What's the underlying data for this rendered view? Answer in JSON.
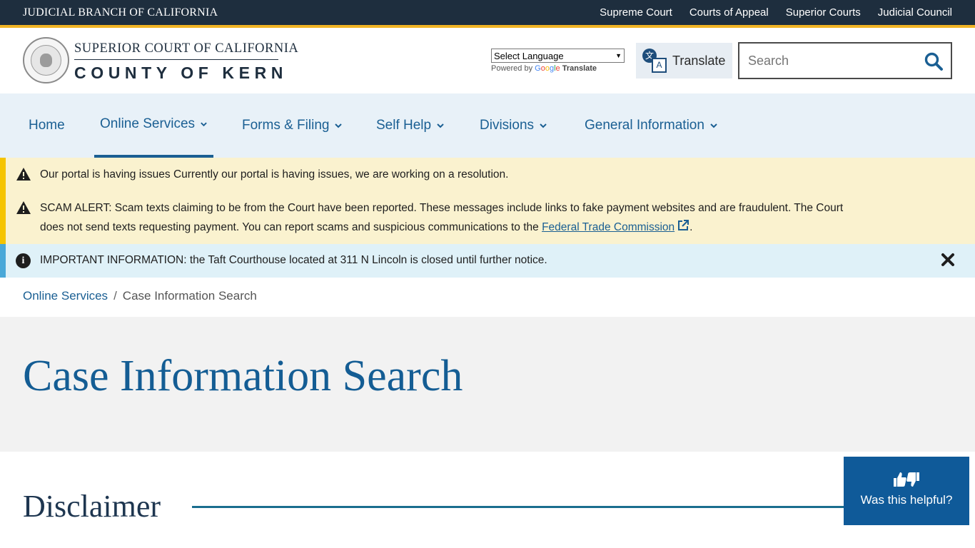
{
  "topbar": {
    "branch": "JUDICIAL BRANCH OF CALIFORNIA",
    "links": [
      "Supreme Court",
      "Courts of Appeal",
      "Superior Courts",
      "Judicial Council"
    ],
    "accent_color": "#f0b323"
  },
  "header": {
    "seal_icon": "court-seal-icon",
    "logo_line1": "SUPERIOR COURT OF CALIFORNIA",
    "logo_line2": "COUNTY OF KERN",
    "language_select": "Select Language",
    "powered_by": "Powered by",
    "google": [
      "G",
      "o",
      "o",
      "g",
      "l",
      "e"
    ],
    "google_translate": "Translate",
    "translate_button": "Translate",
    "search_placeholder": "Search"
  },
  "nav": {
    "items": [
      {
        "label": "Home",
        "dropdown": false
      },
      {
        "label": "Online Services",
        "dropdown": true,
        "active": true
      },
      {
        "label": "Forms & Filing",
        "dropdown": true
      },
      {
        "label": "Self Help",
        "dropdown": true
      },
      {
        "label": "Divisions",
        "dropdown": true
      },
      {
        "label": "General Information",
        "dropdown": true
      }
    ]
  },
  "alerts": {
    "portal": "Our portal is having issues Currently our portal is having issues, we are working on a resolution.",
    "scam_line1": "SCAM ALERT: Scam texts claiming to be from the Court have been reported. These messages include links to fake payment websites and are fraudulent. The Court",
    "scam_line2": "does not send texts requesting payment. You can report scams and suspicious communications to the",
    "scam_link": "Federal Trade Commission",
    "scam_end": ".",
    "info": "IMPORTANT INFORMATION:  the Taft Courthouse located at 311 N Lincoln is closed until further notice."
  },
  "breadcrumb": {
    "parent": "Online Services",
    "separator": "/",
    "current": "Case Information Search"
  },
  "page": {
    "title": "Case Information Search",
    "section_title": "Disclaimer"
  },
  "feedback": {
    "label": "Was this helpful?"
  }
}
